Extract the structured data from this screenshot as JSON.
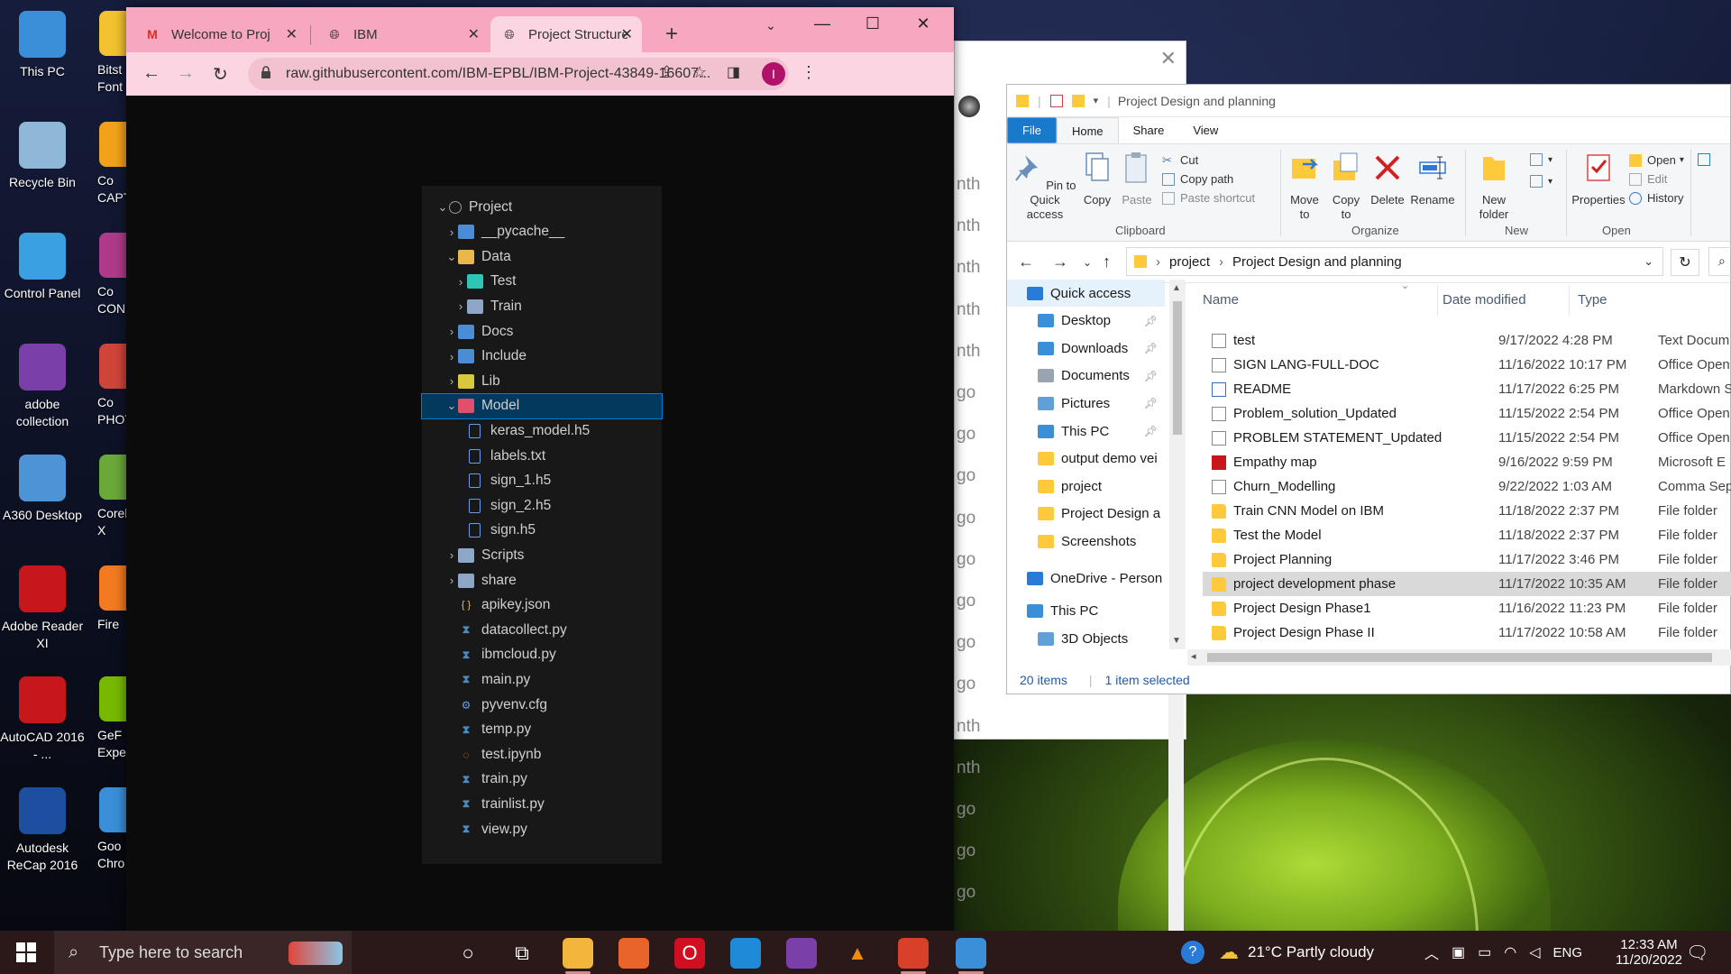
{
  "desktop": {
    "icons": [
      {
        "label": "This PC",
        "icon": "computer-icon",
        "color": "#3a8fd8"
      },
      {
        "label": "Recycle Bin",
        "icon": "recycle-bin-icon",
        "color": "#8fb7d8"
      },
      {
        "label": "Control Panel",
        "icon": "control-panel-icon",
        "color": "#3aa0e0"
      },
      {
        "label": "adobe collection",
        "icon": "winrar-icon",
        "color": "#7a3fa8"
      },
      {
        "label": "A360 Desktop",
        "icon": "a360-icon",
        "color": "#4d94d6"
      },
      {
        "label": "Adobe Reader XI",
        "icon": "adobe-reader-icon",
        "color": "#c8161d"
      },
      {
        "label": "AutoCAD 2016 - ...",
        "icon": "autocad-icon",
        "color": "#c8161d"
      },
      {
        "label": "Autodesk ReCap 2016",
        "icon": "recap-icon",
        "color": "#1c4fa0"
      }
    ],
    "cut_icons": [
      {
        "label": "Bitst Font",
        "color": "#f2c230"
      },
      {
        "label": "Co CAPTU",
        "color": "#f2a21a"
      },
      {
        "label": "Co CONN",
        "color": "#b03a8a"
      },
      {
        "label": "Co PHOTO",
        "color": "#d0453a"
      },
      {
        "label": "Corell X",
        "color": "#6aa83a"
      },
      {
        "label": "Fire",
        "color": "#f37a20"
      },
      {
        "label": "GeF Exper",
        "color": "#76b900"
      },
      {
        "label": "Goo Chro",
        "color": "#3a8fd8"
      }
    ]
  },
  "chrome": {
    "tabs": [
      {
        "title": "Welcome to Proj",
        "icon": "gmail-icon"
      },
      {
        "title": "IBM",
        "icon": "globe-icon"
      },
      {
        "title": "Project Structure",
        "icon": "globe-icon"
      }
    ],
    "new_tab": "+",
    "url": "raw.githubusercontent.com/IBM-EPBL/IBM-Project-43849-16607...",
    "profile_initial": "I",
    "tree": [
      {
        "label": "Project",
        "depth": 0,
        "chev": "⌄",
        "kind": "circle"
      },
      {
        "label": "__pycache__",
        "depth": 1,
        "chev": "›",
        "kind": "folder",
        "color": "#4a8cd6"
      },
      {
        "label": "Data",
        "depth": 1,
        "chev": "⌄",
        "kind": "folder",
        "color": "#e8b84a"
      },
      {
        "label": "Test",
        "depth": 2,
        "chev": "›",
        "kind": "folder",
        "color": "#2ec4b6"
      },
      {
        "label": "Train",
        "depth": 2,
        "chev": "›",
        "kind": "folder",
        "color": "#8ea6c8"
      },
      {
        "label": "Docs",
        "depth": 1,
        "chev": "›",
        "kind": "folder",
        "color": "#4a8cd6"
      },
      {
        "label": "Include",
        "depth": 1,
        "chev": "›",
        "kind": "folder",
        "color": "#4a8cd6"
      },
      {
        "label": "Lib",
        "depth": 1,
        "chev": "›",
        "kind": "folder",
        "color": "#d7c93a"
      },
      {
        "label": "Model",
        "depth": 1,
        "chev": "⌄",
        "kind": "folder",
        "color": "#e0506a",
        "selected": true
      },
      {
        "label": "keras_model.h5",
        "depth": 2,
        "chev": "",
        "kind": "file"
      },
      {
        "label": "labels.txt",
        "depth": 2,
        "chev": "",
        "kind": "file"
      },
      {
        "label": "sign_1.h5",
        "depth": 2,
        "chev": "",
        "kind": "file"
      },
      {
        "label": "sign_2.h5",
        "depth": 2,
        "chev": "",
        "kind": "file"
      },
      {
        "label": "sign.h5",
        "depth": 2,
        "chev": "",
        "kind": "file"
      },
      {
        "label": "Scripts",
        "depth": 1,
        "chev": "›",
        "kind": "folder",
        "color": "#8ea6c8"
      },
      {
        "label": "share",
        "depth": 1,
        "chev": "›",
        "kind": "folder",
        "color": "#8ea6c8"
      },
      {
        "label": "apikey.json",
        "depth": 1,
        "chev": "",
        "kind": "json"
      },
      {
        "label": "datacollect.py",
        "depth": 1,
        "chev": "",
        "kind": "py"
      },
      {
        "label": "ibmcloud.py",
        "depth": 1,
        "chev": "",
        "kind": "py"
      },
      {
        "label": "main.py",
        "depth": 1,
        "chev": "",
        "kind": "py"
      },
      {
        "label": "pyvenv.cfg",
        "depth": 1,
        "chev": "",
        "kind": "cfg"
      },
      {
        "label": "temp.py",
        "depth": 1,
        "chev": "",
        "kind": "py"
      },
      {
        "label": "test.ipynb",
        "depth": 1,
        "chev": "",
        "kind": "ipynb"
      },
      {
        "label": "train.py",
        "depth": 1,
        "chev": "",
        "kind": "py"
      },
      {
        "label": "trainlist.py",
        "depth": 1,
        "chev": "",
        "kind": "py"
      },
      {
        "label": "view.py",
        "depth": 1,
        "chev": "",
        "kind": "py"
      }
    ]
  },
  "backwin": {
    "lines": [
      "nth",
      "nth",
      "nth",
      "nth",
      "nth",
      "go",
      "go",
      "go",
      "go",
      "go",
      "go",
      "go",
      "go",
      "nth",
      "nth",
      "go",
      "go",
      "go"
    ]
  },
  "explorer": {
    "title": "Project Design and planning",
    "ribbon_tabs": [
      "File",
      "Home",
      "Share",
      "View"
    ],
    "clipboard": {
      "pin": "Pin to Quick access",
      "copy": "Copy",
      "paste": "Paste",
      "cut": "Cut",
      "copy_path": "Copy path",
      "paste_shortcut": "Paste shortcut",
      "group": "Clipboard"
    },
    "organize": {
      "move": "Move to",
      "copy": "Copy to",
      "delete": "Delete",
      "rename": "Rename",
      "group": "Organize"
    },
    "new": {
      "folder": "New folder",
      "group": "New"
    },
    "open": {
      "properties": "Properties",
      "open": "Open",
      "edit": "Edit",
      "history": "History",
      "group": "Open"
    },
    "breadcrumb": [
      "project",
      "Project Design and planning"
    ],
    "nav": [
      {
        "label": "Quick access",
        "icon": "star-icon",
        "color": "#2a7bd8",
        "pin": false,
        "indent": 0
      },
      {
        "label": "Desktop",
        "icon": "desktop-icon",
        "color": "#3a8fd8",
        "pin": true,
        "indent": 1
      },
      {
        "label": "Downloads",
        "icon": "download-icon",
        "color": "#3a8fd8",
        "pin": true,
        "indent": 1
      },
      {
        "label": "Documents",
        "icon": "documents-icon",
        "color": "#9aa4b0",
        "pin": true,
        "indent": 1
      },
      {
        "label": "Pictures",
        "icon": "pictures-icon",
        "color": "#5fa0d8",
        "pin": true,
        "indent": 1
      },
      {
        "label": "This PC",
        "icon": "computer-icon",
        "color": "#3a8fd8",
        "pin": true,
        "indent": 1
      },
      {
        "label": "output demo vei",
        "icon": "folder-icon",
        "color": "#ffc93c",
        "pin": false,
        "indent": 1
      },
      {
        "label": "project",
        "icon": "folder-icon",
        "color": "#ffc93c",
        "pin": false,
        "indent": 1
      },
      {
        "label": "Project Design a",
        "icon": "folder-icon",
        "color": "#ffc93c",
        "pin": false,
        "indent": 1
      },
      {
        "label": "Screenshots",
        "icon": "folder-icon",
        "color": "#ffc93c",
        "pin": false,
        "indent": 1
      },
      {
        "label": "OneDrive - Person",
        "icon": "cloud-icon",
        "color": "#2a7bd8",
        "pin": false,
        "indent": 0
      },
      {
        "label": "This PC",
        "icon": "computer-icon",
        "color": "#3a8fd8",
        "pin": false,
        "indent": 0
      },
      {
        "label": "3D Objects",
        "icon": "cube-icon",
        "color": "#5fa0d8",
        "pin": false,
        "indent": 1
      }
    ],
    "columns": [
      "Name",
      "Date modified",
      "Type"
    ],
    "files": [
      {
        "name": "test",
        "date": "9/17/2022 4:28 PM",
        "type": "Text Docum",
        "kind": "doc"
      },
      {
        "name": "SIGN LANG-FULL-DOC",
        "date": "11/16/2022 10:17 PM",
        "type": "Office Open",
        "kind": "doc"
      },
      {
        "name": "README",
        "date": "11/17/2022 6:25 PM",
        "type": "Markdown S",
        "kind": "md"
      },
      {
        "name": "Problem_solution_Updated",
        "date": "11/15/2022 2:54 PM",
        "type": "Office Open",
        "kind": "doc"
      },
      {
        "name": "PROBLEM STATEMENT_Updated",
        "date": "11/15/2022 2:54 PM",
        "type": "Office Open",
        "kind": "doc"
      },
      {
        "name": "Empathy map",
        "date": "9/16/2022 9:59 PM",
        "type": "Microsoft E",
        "kind": "pdf"
      },
      {
        "name": "Churn_Modelling",
        "date": "9/22/2022 1:03 AM",
        "type": "Comma Sep",
        "kind": "doc"
      },
      {
        "name": "Train CNN Model on IBM",
        "date": "11/18/2022 2:37 PM",
        "type": "File folder",
        "kind": "folder"
      },
      {
        "name": "Test the Model",
        "date": "11/18/2022 2:37 PM",
        "type": "File folder",
        "kind": "folder"
      },
      {
        "name": "Project Planning",
        "date": "11/17/2022 3:46 PM",
        "type": "File folder",
        "kind": "folder"
      },
      {
        "name": "project development phase",
        "date": "11/17/2022 10:35 AM",
        "type": "File folder",
        "kind": "folder",
        "selected": true
      },
      {
        "name": "Project Design Phase1",
        "date": "11/16/2022 11:23 PM",
        "type": "File folder",
        "kind": "folder"
      },
      {
        "name": "Project Design Phase II",
        "date": "11/17/2022 10:58 AM",
        "type": "File folder",
        "kind": "folder"
      }
    ],
    "status_items": "20 items",
    "status_selected": "1 item selected"
  },
  "taskbar": {
    "search_placeholder": "Type here to search",
    "weather": "21°C  Partly cloudy",
    "lang": "ENG",
    "time": "12:33 AM",
    "date": "11/20/2022",
    "apps": [
      {
        "name": "cortana-icon",
        "glyph": "○",
        "color": "transparent",
        "open": false
      },
      {
        "name": "task-view-icon",
        "glyph": "⧉",
        "color": "transparent",
        "open": false
      },
      {
        "name": "file-explorer-icon",
        "glyph": "",
        "color": "#f2b63c",
        "open": true
      },
      {
        "name": "firefox-icon",
        "glyph": "",
        "color": "#e8642a",
        "open": false
      },
      {
        "name": "opera-icon",
        "glyph": "O",
        "color": "#d01020",
        "open": false
      },
      {
        "name": "edge-icon",
        "glyph": "",
        "color": "#1f8ad8",
        "open": false
      },
      {
        "name": "winrar-icon",
        "glyph": "",
        "color": "#7a3fa8",
        "open": false
      },
      {
        "name": "vlc-icon",
        "glyph": "▲",
        "color": "transparent",
        "open": false
      },
      {
        "name": "chrome-profile-icon",
        "glyph": "",
        "color": "#d8402a",
        "open": true
      },
      {
        "name": "chrome-icon",
        "glyph": "",
        "color": "#3a8fd8",
        "open": true
      }
    ]
  }
}
